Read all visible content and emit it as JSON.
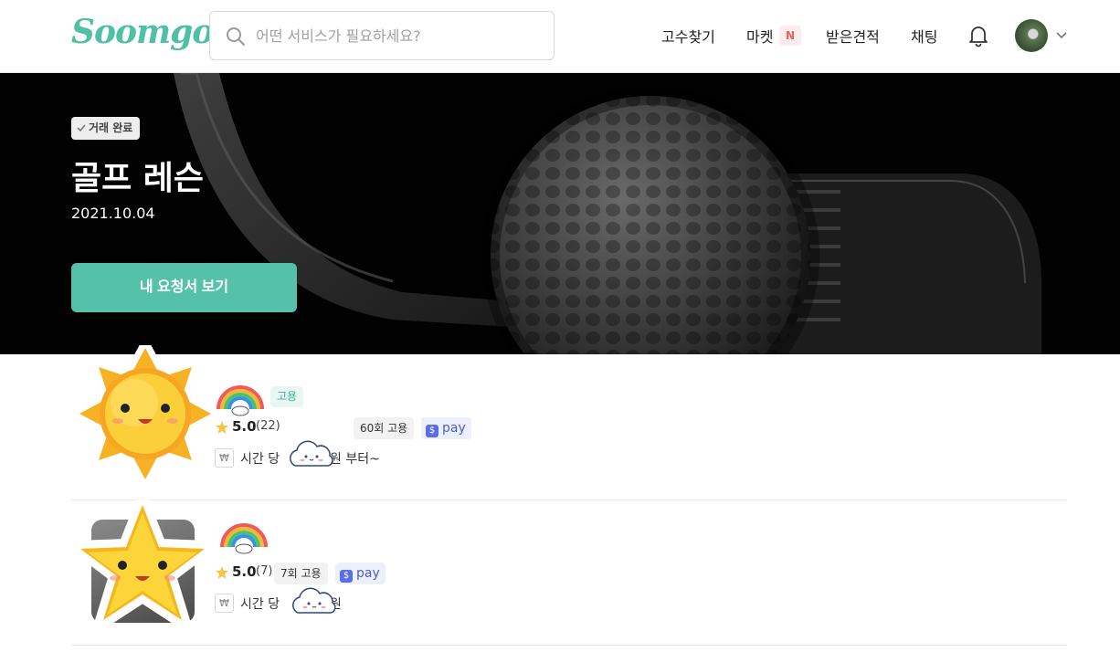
{
  "header": {
    "logo": "Soomgo",
    "search_placeholder": "어떤 서비스가 필요하세요?",
    "nav": {
      "find_pro": "고수찾기",
      "market": "마켓",
      "market_badge": "N",
      "quotes": "받은견적",
      "chat": "채팅"
    },
    "icons": [
      "search-icon",
      "bell-icon",
      "chevron-down-icon"
    ]
  },
  "hero": {
    "status": "거래 완료",
    "title": "골프 레슨",
    "date": "2021.10.04",
    "button": "내 요청서 보기"
  },
  "pros": [
    {
      "tag": "고용",
      "rating": "5.0",
      "reviews": "(22)",
      "hires": "60회 고용",
      "pay_label": "pay",
      "price_prefix": "시간 당",
      "price_suffix": "원 부터~",
      "currency_icon": "₩"
    },
    {
      "tag": "",
      "rating": "5.0",
      "reviews": "(7)",
      "hires": "7회 고용",
      "pay_label": "pay",
      "price_prefix": "시간 당",
      "price_suffix": "원",
      "currency_icon": "₩"
    }
  ],
  "colors": {
    "brand": "#4fc0a7",
    "primary_button": "#55c1a9",
    "badge_red": "#f0615a",
    "pay_blue": "#4b5bd0"
  }
}
